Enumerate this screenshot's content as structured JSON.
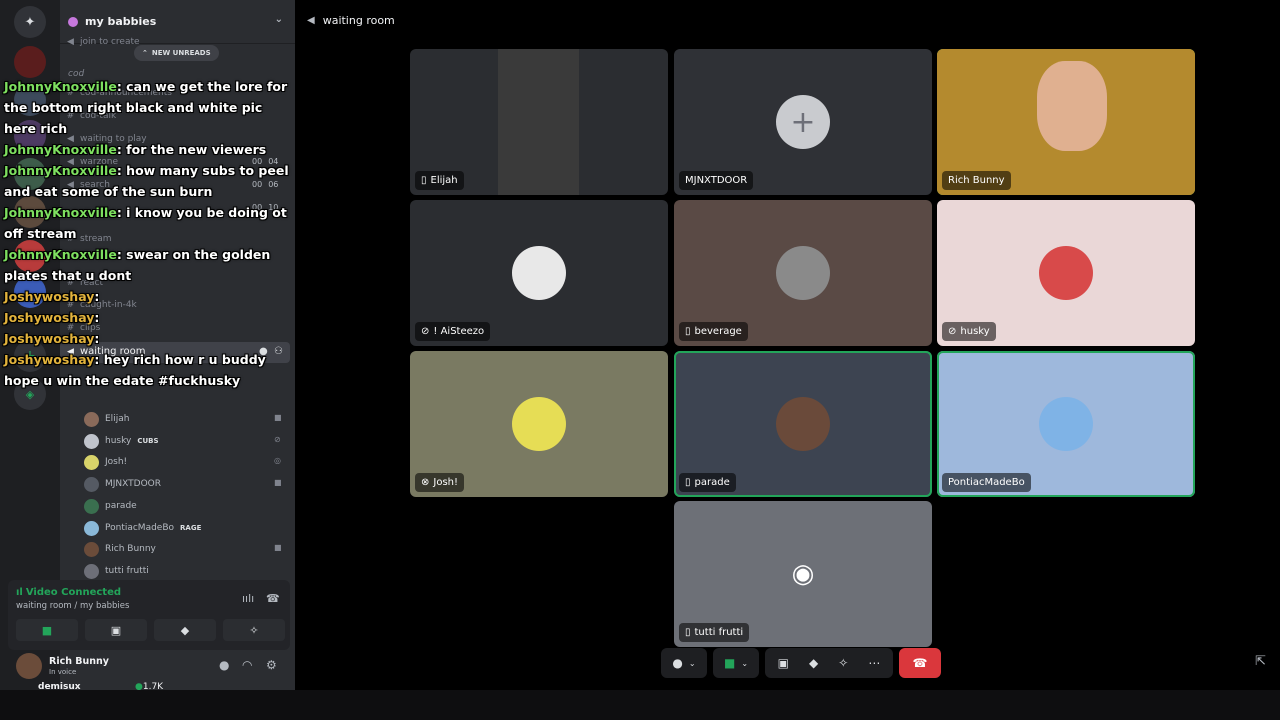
{
  "server": {
    "name": "my babbies"
  },
  "channels": {
    "join_to_create": "join to create",
    "cod_category": "cod",
    "cod_announcements": "cod-announcements",
    "cod_talk": "cod-talk",
    "waiting_to_play": "waiting to play",
    "warzone": "warzone",
    "search": "search",
    "stream": "stream",
    "react": "react",
    "caught_in_4k": "caught-in-4k",
    "clips": "clips",
    "waiting_room": "waiting room",
    "warzone_count": [
      "00",
      "04"
    ],
    "search_count": [
      "00",
      "06"
    ],
    "warzone_count2": [
      "00",
      "10"
    ]
  },
  "new_unreads": "NEW UNREADS",
  "members": [
    {
      "name": "Elijah",
      "color": "#8a6a5a"
    },
    {
      "name": "husky",
      "tag": "CUBS",
      "color": "#c0c4cc"
    },
    {
      "name": "Josh!",
      "tag": "",
      "color": "#d8d36a"
    },
    {
      "name": "MJNXTDOOR",
      "color": "#555a63"
    },
    {
      "name": "parade",
      "color": "#3a6f4f"
    },
    {
      "name": "PontiacMadeBo",
      "tag": "RAGE",
      "color": "#8ab8d8"
    },
    {
      "name": "Rich Bunny",
      "color": "#6b4c3a"
    },
    {
      "name": "tutti frutti",
      "color": "#6d6f78"
    }
  ],
  "chat": [
    {
      "user": "JohnnyKnoxville",
      "user_color": "#7ee060",
      "text": "can we get the lore for the bottom right black and white pic here rich"
    },
    {
      "user": "JohnnyKnoxville",
      "user_color": "#7ee060",
      "text": "for the new viewers"
    },
    {
      "user": "JohnnyKnoxville",
      "user_color": "#7ee060",
      "text": "how many subs to peel and eat some of the sun burn"
    },
    {
      "user": "JohnnyKnoxville",
      "user_color": "#7ee060",
      "text": "i know you be doing ot off stream"
    },
    {
      "user": "JohnnyKnoxville",
      "user_color": "#7ee060",
      "text": "swear on the golden plates that u dont"
    },
    {
      "user": "Joshywoshay",
      "user_color": "#e2b33c",
      "text": ""
    },
    {
      "user": "Joshywoshay",
      "user_color": "#e2b33c",
      "text": ""
    },
    {
      "user": "Joshywoshay",
      "user_color": "#e2b33c",
      "text": ""
    },
    {
      "user": "Joshywoshay",
      "user_color": "#e2b33c",
      "text": "hey rich how r u buddy hope u win the edate #fuckhusky"
    }
  ],
  "voice_panel": {
    "status": "Video Connected",
    "location": "waiting room / my babbies"
  },
  "user_panel": {
    "name": "Rich Bunny",
    "status": "In voice"
  },
  "stream_overlay": {
    "streamer": "demisux",
    "viewers": "1.7K"
  },
  "main": {
    "title": "waiting room",
    "tiles": [
      {
        "name": "Elijah",
        "bg": "#2b2d31",
        "speaking": false,
        "icon": "mobile-icon"
      },
      {
        "name": "MJNXTDOOR",
        "bg": "#2f3136",
        "speaking": false,
        "icon": ""
      },
      {
        "name": "Rich Bunny",
        "bg": "#b48a2e",
        "speaking": true,
        "icon": ""
      },
      {
        "name": "! AiSteezo",
        "bg": "#2b2d31",
        "speaking": false,
        "icon": "muted-icon"
      },
      {
        "name": "beverage",
        "bg": "#5a4a45",
        "speaking": false,
        "icon": "mobile-icon"
      },
      {
        "name": "husky",
        "bg": "#ead7d7",
        "speaking": false,
        "icon": "muted-icon"
      },
      {
        "name": "Josh!",
        "bg": "#7a7a62",
        "speaking": false,
        "icon": "xbox-icon"
      },
      {
        "name": "parade",
        "bg": "#3d4451",
        "speaking": true,
        "icon": "mobile-icon"
      },
      {
        "name": "PontiacMadeBo",
        "bg": "#9eb8dc",
        "speaking": true,
        "icon": ""
      },
      {
        "name": "tutti frutti",
        "bg": "#6d7077",
        "speaking": false,
        "icon": "mobile-icon"
      }
    ]
  },
  "colors": {
    "accent_green": "#23a55a",
    "danger_red": "#da373c"
  }
}
